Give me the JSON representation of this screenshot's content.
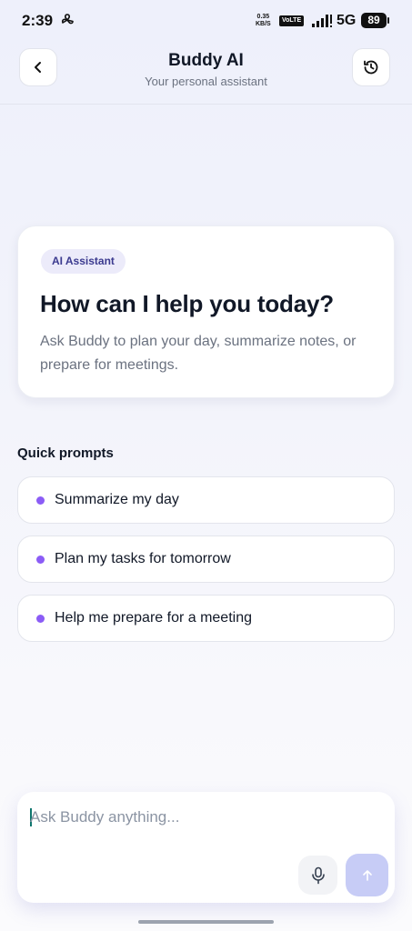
{
  "status_bar": {
    "time": "2:39",
    "speed_value": "0.35",
    "speed_unit": "KB/S",
    "volte": "VoLTE",
    "network": "5G",
    "battery": "89"
  },
  "header": {
    "title": "Buddy AI",
    "subtitle": "Your personal assistant"
  },
  "hero": {
    "badge": "AI Assistant",
    "title": "How can I help you today?",
    "text": "Ask Buddy to plan your day, summarize notes, or prepare for meetings."
  },
  "quick_prompts": {
    "label": "Quick prompts",
    "items": [
      {
        "label": "Summarize my day"
      },
      {
        "label": "Plan my tasks for tomorrow"
      },
      {
        "label": "Help me prepare for a meeting"
      }
    ]
  },
  "composer": {
    "placeholder": "Ask Buddy anything...",
    "value": ""
  },
  "colors": {
    "accent_dot": "#8b5cf6",
    "send_button": "#c7ccf6",
    "badge_bg": "#ecebfa",
    "badge_text": "#3b3a8f"
  },
  "icons": {
    "back": "chevron-left-icon",
    "history": "history-icon",
    "mic": "microphone-icon",
    "send": "arrow-up-icon"
  }
}
